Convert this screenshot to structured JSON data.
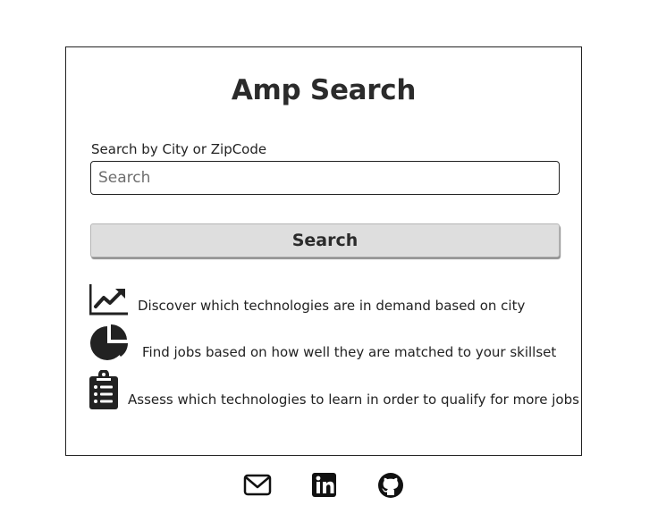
{
  "card": {
    "title": "Amp Search",
    "search": {
      "label": "Search by City or ZipCode",
      "placeholder": "Search",
      "value": "",
      "button_label": "Search"
    },
    "features": [
      {
        "icon": "line-chart-icon",
        "text": "Discover which technologies are in demand based on city"
      },
      {
        "icon": "pie-chart-icon",
        "text": "Find jobs based on how well they are matched to your skillset"
      },
      {
        "icon": "clipboard-list-icon",
        "text": "Assess which technologies to learn in order to qualify for more jobs"
      }
    ]
  },
  "footer": {
    "links": [
      {
        "icon": "email-icon"
      },
      {
        "icon": "linkedin-icon"
      },
      {
        "icon": "github-icon"
      }
    ]
  },
  "colors": {
    "text": "#222222",
    "border": "#222222",
    "button_bg": "#dedede"
  }
}
